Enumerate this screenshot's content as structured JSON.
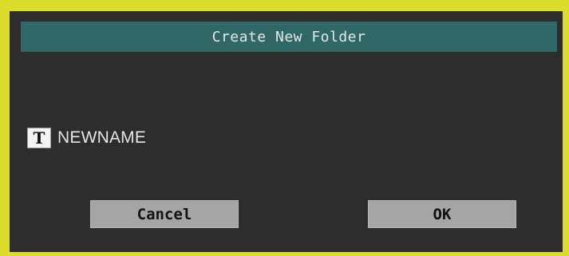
{
  "dialog": {
    "title": "Create New Folder",
    "icon_glyph": "T",
    "icon_name": "text-edit-icon",
    "folder_name": "NEWNAME",
    "cancel_label": "Cancel",
    "ok_label": "OK"
  },
  "colors": {
    "frame": "#dcdc2c",
    "background": "#2d2d2d",
    "title_bar": "#306767",
    "button": "#a5a5a5",
    "text": "#e6e6e6"
  }
}
